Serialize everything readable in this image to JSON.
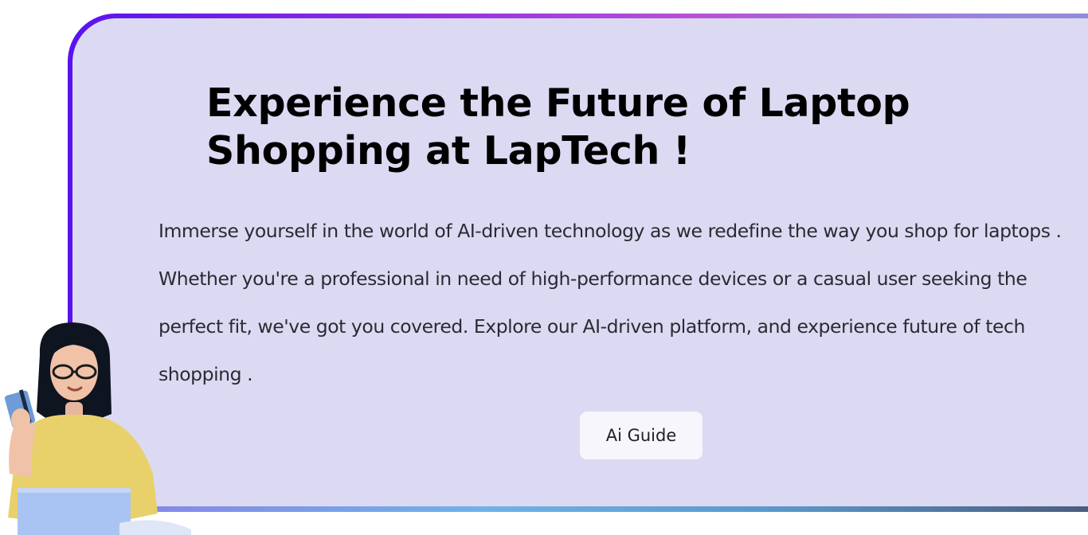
{
  "hero": {
    "title": "Experience the Future of Laptop Shopping at LapTech !",
    "description": "Immerse yourself in the world of AI-driven technology as we redefine the way you shop for laptops . Whether you're a professional in need of high-performance devices or a casual user seeking the perfect fit, we've got you covered. Explore our AI-driven platform, and experience future of tech shopping .",
    "button_label": "Ai Guide"
  },
  "colors": {
    "card_background": "#dcdaf2",
    "border_gradient_start": "#5a12f0",
    "border_gradient_end": "#8f8fd8",
    "button_background": "#f7f6fc"
  },
  "illustration": {
    "icon": "woman-with-credit-card-and-laptop"
  }
}
